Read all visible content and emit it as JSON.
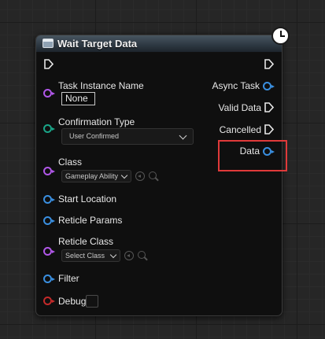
{
  "node": {
    "title": "Wait Target Data",
    "header_icon": "function-node-icon",
    "latent_icon": "clock-icon"
  },
  "inputs": {
    "task_instance_name": {
      "label": "Task Instance Name",
      "value": "None"
    },
    "confirmation_type": {
      "label": "Confirmation Type",
      "selected": "User Confirmed"
    },
    "class": {
      "label": "Class",
      "selected": "Gameplay Ability"
    },
    "start_location": {
      "label": "Start Location"
    },
    "reticle_params": {
      "label": "Reticle Params"
    },
    "reticle_class": {
      "label": "Reticle Class",
      "selected": "Select Class"
    },
    "filter": {
      "label": "Filter"
    },
    "debug": {
      "label": "Debug",
      "checked": false
    }
  },
  "outputs": {
    "async_task": {
      "label": "Async Task"
    },
    "valid_data": {
      "label": "Valid Data"
    },
    "cancelled": {
      "label": "Cancelled"
    },
    "data": {
      "label": "Data"
    }
  },
  "colors": {
    "object_pin": "#3a8fe0",
    "purple_pin": "#b057e8",
    "enum_pin": "#1aa588",
    "bool_pin": "#c42a2a",
    "highlight": "#e03a3a",
    "header": "#3a4752"
  }
}
